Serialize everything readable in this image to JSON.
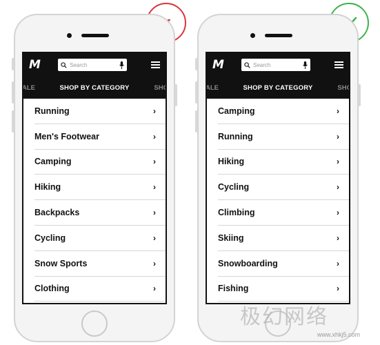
{
  "bad_example": {
    "status_icon": "close-icon",
    "status_symbol": "x",
    "status_color": "#d8343b",
    "logo": "M",
    "search_placeholder": "Search",
    "category_bar": {
      "left": "ALE",
      "center": "SHOP BY CATEGORY",
      "right": "SHO"
    },
    "items": [
      "Running",
      "Men's Footwear",
      "Camping",
      "Hiking",
      "Backpacks",
      "Cycling",
      "Snow Sports",
      "Clothing"
    ]
  },
  "good_example": {
    "status_icon": "check-icon",
    "status_color": "#3eb24b",
    "logo": "M",
    "search_placeholder": "Search",
    "category_bar": {
      "left": "ALE",
      "center": "SHOP BY CATEGORY",
      "right": "SHO"
    },
    "items": [
      "Camping",
      "Running",
      "Hiking",
      "Cycling",
      "Climbing",
      "Skiing",
      "Snowboarding",
      "Fishing"
    ]
  },
  "chevron": "›",
  "watermark": {
    "cn_text": "极幻网络",
    "site": "www.xhkj5.com"
  }
}
